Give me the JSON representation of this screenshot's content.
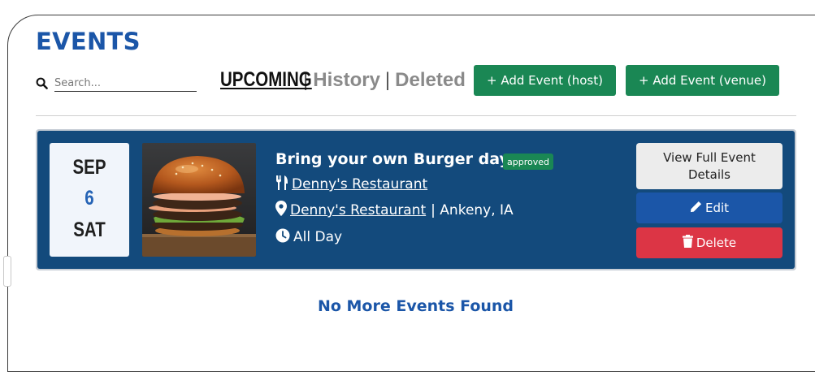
{
  "page": {
    "title": "EVENTS",
    "no_more_text": "No More Events Found"
  },
  "search": {
    "placeholder": "Search...",
    "value": ""
  },
  "tabs": {
    "upcoming": "UPCOMING",
    "separator": "|",
    "history": "History",
    "deleted": "Deleted",
    "active": "UPCOMING"
  },
  "toolbar": {
    "add_host_label": "+ Add Event (host)",
    "add_venue_label": "+ Add Event (venue)"
  },
  "events": [
    {
      "month": "SEP",
      "day": "6",
      "weekday": "SAT",
      "title": "Bring your own Burger day",
      "status": "approved",
      "host": "Denny's Restaurant",
      "venue": "Denny's Restaurant",
      "location": "| Ankeny, IA",
      "time": "All Day",
      "view_label": "View Full Event Details",
      "edit_label": "Edit",
      "delete_label": "Delete"
    }
  ],
  "icons": {
    "search": "search-icon",
    "host": "utensils-icon",
    "venue": "map-marker-icon",
    "time": "clock-icon",
    "edit": "pencil-icon",
    "delete": "trash-icon"
  },
  "colors": {
    "title_blue": "#1b56a8",
    "card_bg": "#134a7c",
    "green": "#1a8754",
    "danger": "#dc3545",
    "edit_blue": "#1b56a8"
  }
}
